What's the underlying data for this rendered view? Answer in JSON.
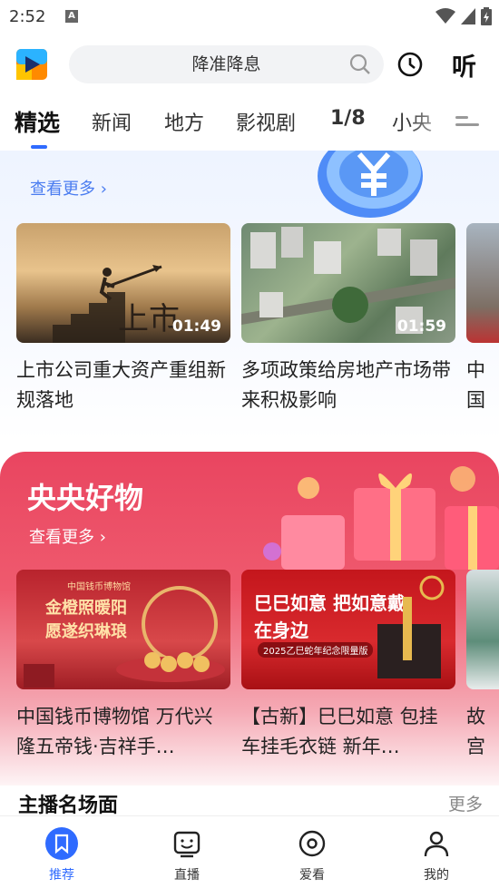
{
  "status": {
    "time": "2:52"
  },
  "header": {
    "search_placeholder": "降准降息",
    "listen_label": "听"
  },
  "tabs": [
    {
      "label": "精选"
    },
    {
      "label": "新闻"
    },
    {
      "label": "地方"
    },
    {
      "label": "影视剧"
    },
    {
      "label": "1/8"
    },
    {
      "label": "小央"
    }
  ],
  "finance": {
    "more_label": "查看更多",
    "items": [
      {
        "duration": "01:49",
        "title": "上市公司重大资产重组新规落地",
        "thumb_text": "上市"
      },
      {
        "duration": "01:59",
        "title": "多项政策给房地产市场带来积极影响"
      },
      {
        "duration": "",
        "title": "中国器数"
      }
    ]
  },
  "shop": {
    "title": "央央好物",
    "more_label": "查看更多",
    "items": [
      {
        "title": "中国钱币博物馆 万代兴隆五帝钱·吉祥手…",
        "thumb_text": "金橙照暖阳 愿遂织琳琅",
        "thumb_small": "中国钱币博物馆"
      },
      {
        "title": "【古新】巳巳如意 包挂车挂毛衣链 新年…",
        "thumb_text": "巳巳如意 把如意戴在身边",
        "thumb_small": "2025乙巳蛇年纪念限量版"
      },
      {
        "title": "故宫美\"古"
      }
    ]
  },
  "anchor": {
    "title": "主播名场面",
    "more_label": "更多"
  },
  "bottom_nav": [
    {
      "label": "推荐"
    },
    {
      "label": "直播"
    },
    {
      "label": "爱看"
    },
    {
      "label": "我的"
    }
  ],
  "colors": {
    "accent": "#2f6bff",
    "shop_red": "#e94560"
  }
}
